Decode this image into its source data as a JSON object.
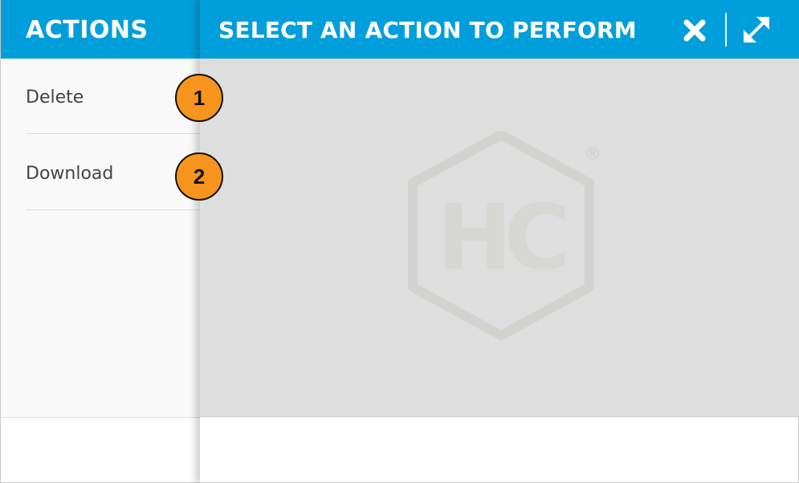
{
  "sidebar": {
    "title": "ACTIONS",
    "items": [
      {
        "label": "Delete"
      },
      {
        "label": "Download"
      }
    ]
  },
  "panel": {
    "title": "SELECT AN ACTION TO PERFORM",
    "close_icon": "close-icon",
    "expand_icon": "expand-icon",
    "logo_text": "HC",
    "registered_mark": "®"
  },
  "markers": [
    "1",
    "2"
  ],
  "colors": {
    "header_blue": "#009fdc",
    "marker_orange": "#f7941d",
    "body_gray": "#dedede",
    "sidebar_bg": "#f9f9f9"
  }
}
